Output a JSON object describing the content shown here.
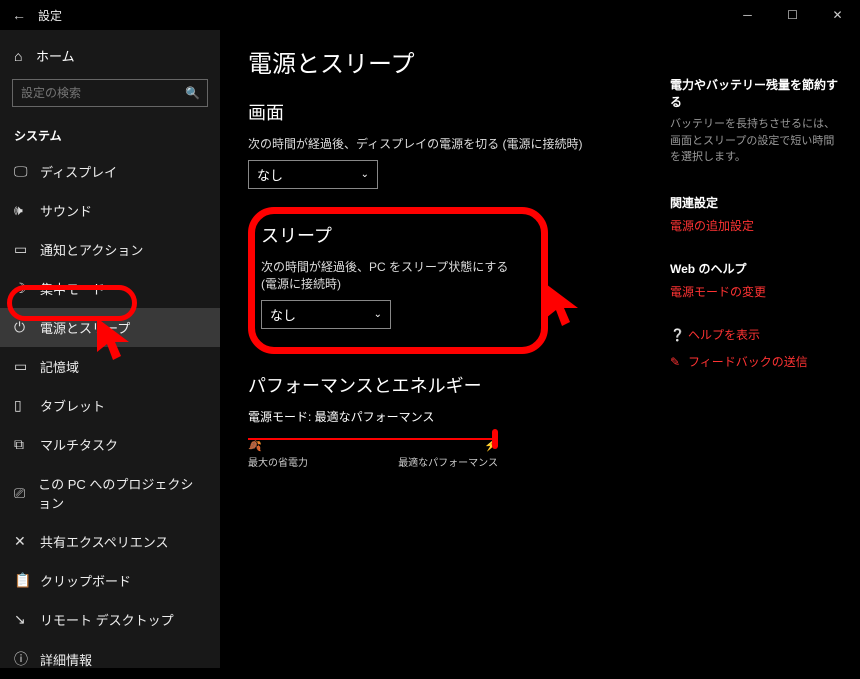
{
  "window": {
    "title": "設定"
  },
  "sidebar": {
    "home": "ホーム",
    "search_placeholder": "設定の検索",
    "category": "システム",
    "items": [
      {
        "label": "ディスプレイ",
        "icon": "🖵"
      },
      {
        "label": "サウンド",
        "icon": "🔊"
      },
      {
        "label": "通知とアクション",
        "icon": "▭"
      },
      {
        "label": "集中モード",
        "icon": "☽"
      },
      {
        "label": "電源とスリープ",
        "icon": "⏻",
        "selected": true
      },
      {
        "label": "記憶域",
        "icon": "▭"
      },
      {
        "label": "タブレット",
        "icon": "▯"
      },
      {
        "label": "マルチタスク",
        "icon": "⧉"
      },
      {
        "label": "この PC へのプロジェクション",
        "icon": "⎚"
      },
      {
        "label": "共有エクスペリエンス",
        "icon": "✕"
      },
      {
        "label": "クリップボード",
        "icon": "📋"
      },
      {
        "label": "リモート デスクトップ",
        "icon": "↘"
      },
      {
        "label": "詳細情報",
        "icon": "ⓘ"
      }
    ]
  },
  "main": {
    "title": "電源とスリープ",
    "screen_h": "画面",
    "screen_sub": "次の時間が経過後、ディスプレイの電源を切る (電源に接続時)",
    "screen_val": "なし",
    "sleep_h": "スリープ",
    "sleep_sub": "次の時間が経過後、PC をスリープ状態にする (電源に接続時)",
    "sleep_val": "なし",
    "perf_h": "パフォーマンスとエネルギー",
    "perf_label": "電源モード: 最適なパフォーマンス",
    "slider_left": "最大の省電力",
    "slider_right": "最適なパフォーマンス"
  },
  "right": {
    "save_h": "電力やバッテリー残量を節約する",
    "save_p": "バッテリーを長持ちさせるには、画面とスリープの設定で短い時間を選択します。",
    "related_h": "関連設定",
    "related_link": "電源の追加設定",
    "help_h": "Web のヘルプ",
    "help_link": "電源モードの変更",
    "show_help": "ヘルプを表示",
    "feedback": "フィードバックの送信"
  }
}
